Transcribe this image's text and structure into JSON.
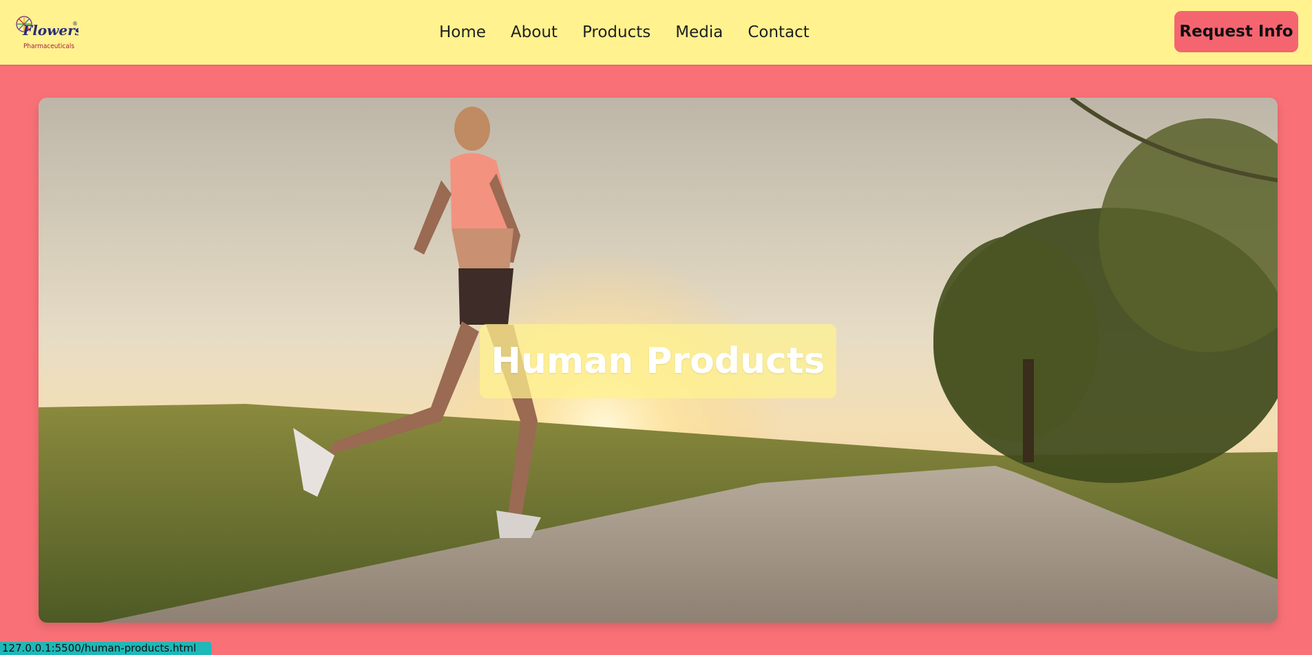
{
  "header": {
    "logo": {
      "brand": "Flowers",
      "sub": "Pharmaceuticals",
      "mark": "®",
      "icon": "flower-wheel-icon"
    },
    "nav": [
      {
        "label": "Home"
      },
      {
        "label": "About"
      },
      {
        "label": "Products"
      },
      {
        "label": "Media"
      },
      {
        "label": "Contact"
      }
    ],
    "cta_label": "Request Info"
  },
  "hero": {
    "title": "Human Products",
    "image": "woman-running-at-sunset-photo"
  },
  "status_bar": {
    "url": "127.0.0.1:5500/human-products.html"
  },
  "colors": {
    "header_bg": "#fff28f",
    "page_bg": "#f97177",
    "cta_bg": "#f46570",
    "title_box": "#fff28f",
    "status_bg": "#1eb8b8"
  }
}
